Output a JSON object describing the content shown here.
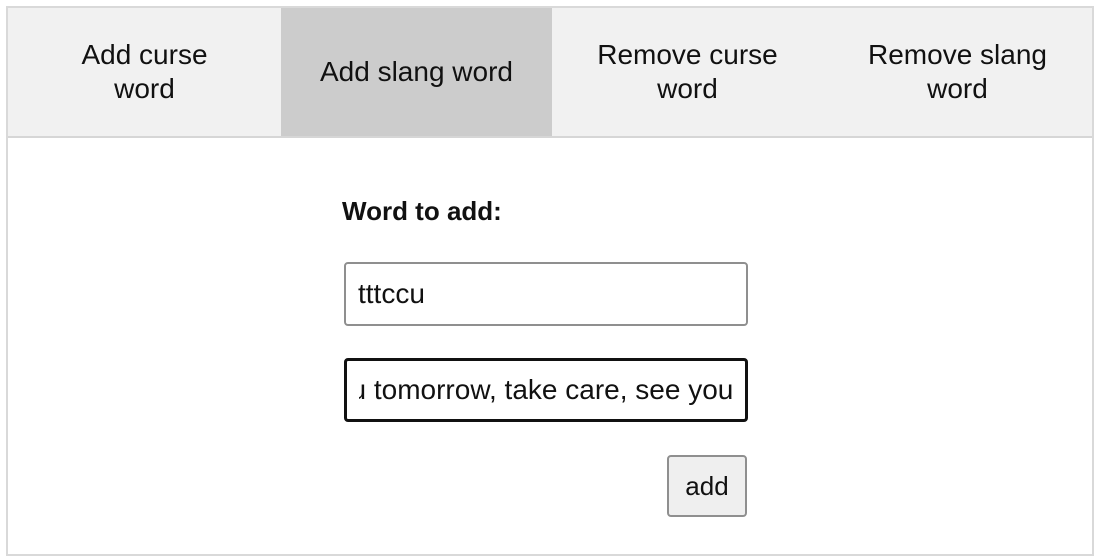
{
  "tabs": [
    {
      "line1": "Add curse",
      "line2": "word",
      "active": false
    },
    {
      "line1": "Add slang word",
      "line2": "",
      "active": true
    },
    {
      "line1": "Remove curse",
      "line2": "word",
      "active": false
    },
    {
      "line1": "Remove slang",
      "line2": "word",
      "active": false
    }
  ],
  "form": {
    "label": "Word to add:",
    "word_value": "tttccu",
    "meaning_value": "see you tomorrow, take care, see you",
    "add_label": "add"
  },
  "colors": {
    "tabbar_bg": "#f1f1f1",
    "active_tab_bg": "#cccccc",
    "focused_border": "#111111"
  }
}
